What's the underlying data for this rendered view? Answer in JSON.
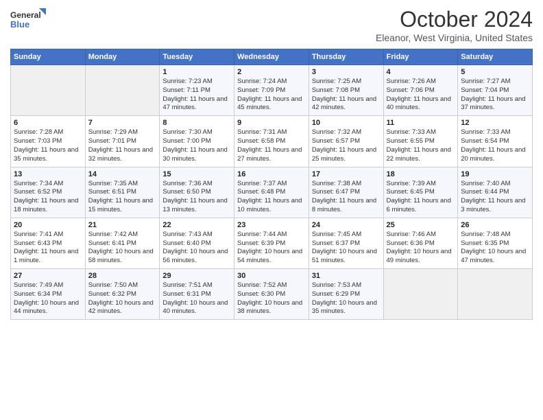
{
  "header": {
    "logo_line1": "General",
    "logo_line2": "Blue",
    "title": "October 2024",
    "subtitle": "Eleanor, West Virginia, United States"
  },
  "days_of_week": [
    "Sunday",
    "Monday",
    "Tuesday",
    "Wednesday",
    "Thursday",
    "Friday",
    "Saturday"
  ],
  "weeks": [
    [
      {
        "day": "",
        "empty": true
      },
      {
        "day": "",
        "empty": true
      },
      {
        "day": "1",
        "sunrise": "7:23 AM",
        "sunset": "7:11 PM",
        "daylight": "11 hours and 47 minutes."
      },
      {
        "day": "2",
        "sunrise": "7:24 AM",
        "sunset": "7:09 PM",
        "daylight": "11 hours and 45 minutes."
      },
      {
        "day": "3",
        "sunrise": "7:25 AM",
        "sunset": "7:08 PM",
        "daylight": "11 hours and 42 minutes."
      },
      {
        "day": "4",
        "sunrise": "7:26 AM",
        "sunset": "7:06 PM",
        "daylight": "11 hours and 40 minutes."
      },
      {
        "day": "5",
        "sunrise": "7:27 AM",
        "sunset": "7:04 PM",
        "daylight": "11 hours and 37 minutes."
      }
    ],
    [
      {
        "day": "6",
        "sunrise": "7:28 AM",
        "sunset": "7:03 PM",
        "daylight": "11 hours and 35 minutes."
      },
      {
        "day": "7",
        "sunrise": "7:29 AM",
        "sunset": "7:01 PM",
        "daylight": "11 hours and 32 minutes."
      },
      {
        "day": "8",
        "sunrise": "7:30 AM",
        "sunset": "7:00 PM",
        "daylight": "11 hours and 30 minutes."
      },
      {
        "day": "9",
        "sunrise": "7:31 AM",
        "sunset": "6:58 PM",
        "daylight": "11 hours and 27 minutes."
      },
      {
        "day": "10",
        "sunrise": "7:32 AM",
        "sunset": "6:57 PM",
        "daylight": "11 hours and 25 minutes."
      },
      {
        "day": "11",
        "sunrise": "7:33 AM",
        "sunset": "6:55 PM",
        "daylight": "11 hours and 22 minutes."
      },
      {
        "day": "12",
        "sunrise": "7:33 AM",
        "sunset": "6:54 PM",
        "daylight": "11 hours and 20 minutes."
      }
    ],
    [
      {
        "day": "13",
        "sunrise": "7:34 AM",
        "sunset": "6:52 PM",
        "daylight": "11 hours and 18 minutes."
      },
      {
        "day": "14",
        "sunrise": "7:35 AM",
        "sunset": "6:51 PM",
        "daylight": "11 hours and 15 minutes."
      },
      {
        "day": "15",
        "sunrise": "7:36 AM",
        "sunset": "6:50 PM",
        "daylight": "11 hours and 13 minutes."
      },
      {
        "day": "16",
        "sunrise": "7:37 AM",
        "sunset": "6:48 PM",
        "daylight": "11 hours and 10 minutes."
      },
      {
        "day": "17",
        "sunrise": "7:38 AM",
        "sunset": "6:47 PM",
        "daylight": "11 hours and 8 minutes."
      },
      {
        "day": "18",
        "sunrise": "7:39 AM",
        "sunset": "6:45 PM",
        "daylight": "11 hours and 6 minutes."
      },
      {
        "day": "19",
        "sunrise": "7:40 AM",
        "sunset": "6:44 PM",
        "daylight": "11 hours and 3 minutes."
      }
    ],
    [
      {
        "day": "20",
        "sunrise": "7:41 AM",
        "sunset": "6:43 PM",
        "daylight": "11 hours and 1 minute."
      },
      {
        "day": "21",
        "sunrise": "7:42 AM",
        "sunset": "6:41 PM",
        "daylight": "10 hours and 58 minutes."
      },
      {
        "day": "22",
        "sunrise": "7:43 AM",
        "sunset": "6:40 PM",
        "daylight": "10 hours and 56 minutes."
      },
      {
        "day": "23",
        "sunrise": "7:44 AM",
        "sunset": "6:39 PM",
        "daylight": "10 hours and 54 minutes."
      },
      {
        "day": "24",
        "sunrise": "7:45 AM",
        "sunset": "6:37 PM",
        "daylight": "10 hours and 51 minutes."
      },
      {
        "day": "25",
        "sunrise": "7:46 AM",
        "sunset": "6:36 PM",
        "daylight": "10 hours and 49 minutes."
      },
      {
        "day": "26",
        "sunrise": "7:48 AM",
        "sunset": "6:35 PM",
        "daylight": "10 hours and 47 minutes."
      }
    ],
    [
      {
        "day": "27",
        "sunrise": "7:49 AM",
        "sunset": "6:34 PM",
        "daylight": "10 hours and 44 minutes."
      },
      {
        "day": "28",
        "sunrise": "7:50 AM",
        "sunset": "6:32 PM",
        "daylight": "10 hours and 42 minutes."
      },
      {
        "day": "29",
        "sunrise": "7:51 AM",
        "sunset": "6:31 PM",
        "daylight": "10 hours and 40 minutes."
      },
      {
        "day": "30",
        "sunrise": "7:52 AM",
        "sunset": "6:30 PM",
        "daylight": "10 hours and 38 minutes."
      },
      {
        "day": "31",
        "sunrise": "7:53 AM",
        "sunset": "6:29 PM",
        "daylight": "10 hours and 35 minutes."
      },
      {
        "day": "",
        "empty": true
      },
      {
        "day": "",
        "empty": true
      }
    ]
  ],
  "labels": {
    "sunrise_label": "Sunrise:",
    "sunset_label": "Sunset:",
    "daylight_label": "Daylight:"
  }
}
